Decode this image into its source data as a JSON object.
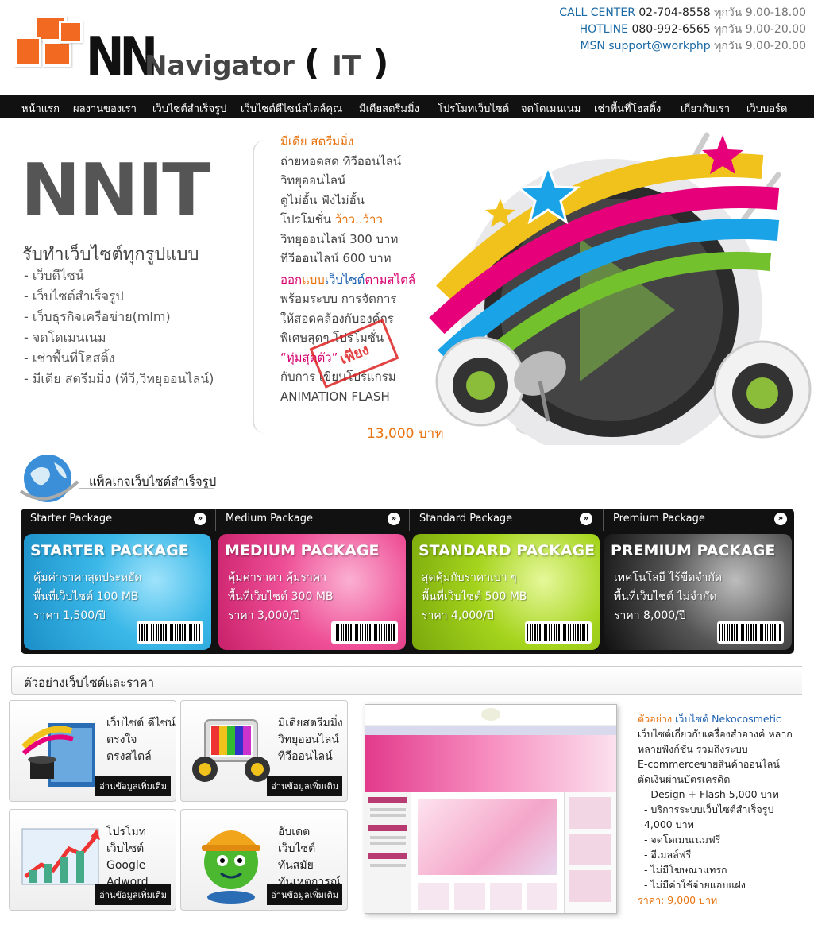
{
  "brand": {
    "logo_letters": "NN",
    "name": "Navigator",
    "name_paren": "IT"
  },
  "contact": [
    {
      "label": "CALL CENTER",
      "value": "02-704-8558",
      "hours": "ทุกวัน 9.00-18.00"
    },
    {
      "label": "HOTLINE",
      "value": "080-992-6565",
      "hours": "ทุกวัน 9.00-20.00"
    },
    {
      "label": "MSN",
      "value": "support@workphp",
      "hours": "ทุกวัน 9.00-20.00"
    }
  ],
  "nav": [
    "หน้าแรก",
    "ผลงานของเรา",
    "เว็บไซต์สำเร็จรูป",
    "เว็บไซต์ดีไซน์สไตล์คุณ",
    "มีเดียสตรีมมิ่ง",
    "โปรโมทเว็บไซต์",
    "จดโดเมนเนม",
    "เช่าพื้นที่โฮสติ้ง",
    "เกี่ยวกับเรา",
    "เว็บบอร์ด"
  ],
  "hero": {
    "title": "NNIT",
    "subtitle": "รับทำเว็บไซต์ทุกรูปแบบ",
    "services": [
      "- เว็บดีไซน์",
      "- เว็บไซต์สำเร็จรูป",
      "- เว็บธุรกิจเครือข่าย(mlm)",
      "- จดโดเมนเนม",
      "- เช่าพื้นที่โฮสติ้ง",
      "- มีเดีย สตรีมมิ่ง (ทีวี,วิทยุออนไลน์)"
    ],
    "media_heading": "มีเดีย สตรีมมิ่ง",
    "media_lines": [
      "ถ่ายทอดสด ทีวีออนไลน์",
      "วิทยุออนไลน์",
      "ดูไม่อั้น ฟังไม่อั้น"
    ],
    "promo_prefix": "โปรโมชั่น ",
    "promo_highlight": "ว้าว..ว้าว",
    "price_lines": [
      "วิทยุออนไลน์ 300 บาท",
      "ทีวีออนไลน์ 600 บาท"
    ],
    "design_heading_1": "ออก",
    "design_heading_2": "แบบ",
    "design_heading_3": "เว็บไซต์",
    "design_heading_4": "ตามสไตล์",
    "design_lines": [
      "พร้อมระบบ การจัดการ",
      "ให้สอดคล้องกับองค์กร",
      "พิเศษสุดๆ โปรโมชั่น"
    ],
    "special": "“ทุ่มสุดตัว”",
    "extra_lines": [
      "กับการ เขียนโปรแกรม",
      "ANIMATION FLASH"
    ],
    "stamp": "เพียง",
    "price": "13,000 บาท"
  },
  "packages": {
    "section_title": "แพ็คเกจเว็บไซต์สำเร็จรูป",
    "items": [
      {
        "tab": "Starter Package",
        "title": "STARTER PACKAGE",
        "line1": "คุ้มค่าราคาสุดประหยัด",
        "line2": "พื้นที่เว็บไซต์ 100 MB",
        "line3": "ราคา 1,500/ปี",
        "color": "#3bb8e8"
      },
      {
        "tab": "Medium Package",
        "title": "MEDIUM PACKAGE",
        "line1": "คุ้มค่าราคา คุ้มราคา",
        "line2": "พื้นที่เว็บไซต์ 300 MB",
        "line3": "ราคา 3,000/ปี",
        "color": "#ee4f96"
      },
      {
        "tab": "Standard Package",
        "title": "STANDARD PACKAGE",
        "line1": "สุดคุ้มกับราคาเบา ๆ",
        "line2": "พื้นที่เว็บไซต์ 500 MB",
        "line3": "ราคา 4,000/ปี",
        "color": "#a5d41d"
      },
      {
        "tab": "Premium Package",
        "title": "PREMIUM PACKAGE",
        "line1": "เทคโนโลยี ไร้ขีดจำกัด",
        "line2": "พื้นที่เว็บไซต์ ไม่จำกัด",
        "line3": "ราคา 8,000/ปี",
        "color": "#3a3a3a"
      }
    ]
  },
  "examples": {
    "section_title": "ตัวอย่างเว็บไซต์และราคา",
    "more_label": "อ่านข้อมูลเพิ่มเติม",
    "boxes": [
      {
        "lines": [
          "เว็บไซต์ ดีไซน์",
          "ตรงใจ",
          "ตรงสไตล์"
        ]
      },
      {
        "lines": [
          "มีเดียสตรีมมิ่ง",
          "วิทยุออนไลน์",
          "ทีวีออนไลน์"
        ]
      },
      {
        "lines": [
          "โปรโมทเว็บไซต์",
          "Google",
          "Adword"
        ]
      },
      {
        "lines": [
          "อับเดตเว็บไซต์",
          "ทันสมัย",
          "ทันเหตุการณ์"
        ]
      }
    ],
    "sample": {
      "prefix": "ตัวอย่าง",
      "site_label": " เว็บไซต์ Nekocosmetic",
      "lines": [
        "เว็บไซต์เกี่ยวกับเครื่องสำอางค์ หลาก",
        "หลายฟังก์ชั่น รวมถึงระบบ",
        "E-commerceขายสินค้าออนไลน์",
        "ตัดเงินผ่านบัตรเครดิต",
        "  - Design + Flash 5,000 บาท",
        "  - บริการระบบเว็บไซต์สำเร็จรูป",
        "  4,000 บาท",
        "  - จดโดเมนเนมฟรี",
        "  - อีเมลล์ฟรี",
        "  - ไม่มีโฆษณาแทรก",
        "  - ไม่มีค่าใช้จ่ายแอบแฝง"
      ],
      "price": "ราคา: 9,000 บาท"
    }
  },
  "colors": {
    "accent_orange": "#f26a21",
    "nav_bg": "#111111",
    "link_blue": "#1b6aa5"
  }
}
